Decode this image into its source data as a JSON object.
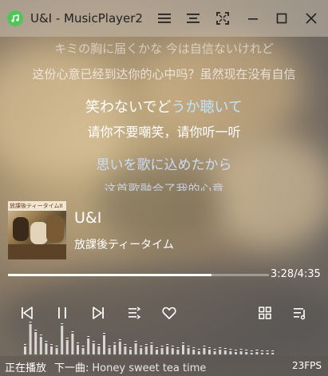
{
  "window": {
    "title": "U&I - MusicPlayer2"
  },
  "titlebar_icons": [
    "menu-icon",
    "minimize-to-mini-icon",
    "fullscreen-icon",
    "minimize-icon",
    "maximize-icon",
    "close-icon"
  ],
  "lyrics": {
    "previous_jp": "キミの胸に届くかな 今は自信ないけれど",
    "previous_cn": "这份心意已经到达你的心中吗？虽然现在没有自信",
    "current_jp_sung": "笑わないでど",
    "current_jp_unsung": "うか聴いて",
    "current_cn": "请你不要嘲笑，请你听一听",
    "next_jp": "思いを歌に込めたから",
    "next_cn": "这首歌融合了我的心意"
  },
  "song": {
    "title": "U&I",
    "artist": "放課後ティータイム",
    "album_art_text": "放課後ティータイムII"
  },
  "playback": {
    "progress": 0.78,
    "time": "3:28/4:35"
  },
  "controls": [
    "previous-icon",
    "pause-icon",
    "next-icon",
    "playlist-mode-icon",
    "favorite-icon",
    "media-library-icon",
    "playlist-icon"
  ],
  "spectrum": [
    10,
    38,
    28,
    22,
    14,
    10,
    8,
    36,
    18,
    26,
    12,
    8,
    20,
    14,
    10,
    24,
    8,
    12,
    16,
    10,
    6,
    14,
    8,
    10,
    12,
    6,
    8,
    10,
    8,
    6,
    12,
    8,
    6,
    4,
    8,
    6,
    4,
    6,
    5,
    4,
    3,
    4,
    3,
    2,
    3,
    2,
    2,
    2
  ],
  "status": {
    "playing": "正在播放",
    "next_label": "下一曲:",
    "next_song": "Honey sweet tea time",
    "fps": "23FPS"
  },
  "colors": {
    "sung": "#ffffff",
    "unsung": "#bfe3ff",
    "faded": "#e8e2da",
    "accent": "#4fc55a"
  }
}
